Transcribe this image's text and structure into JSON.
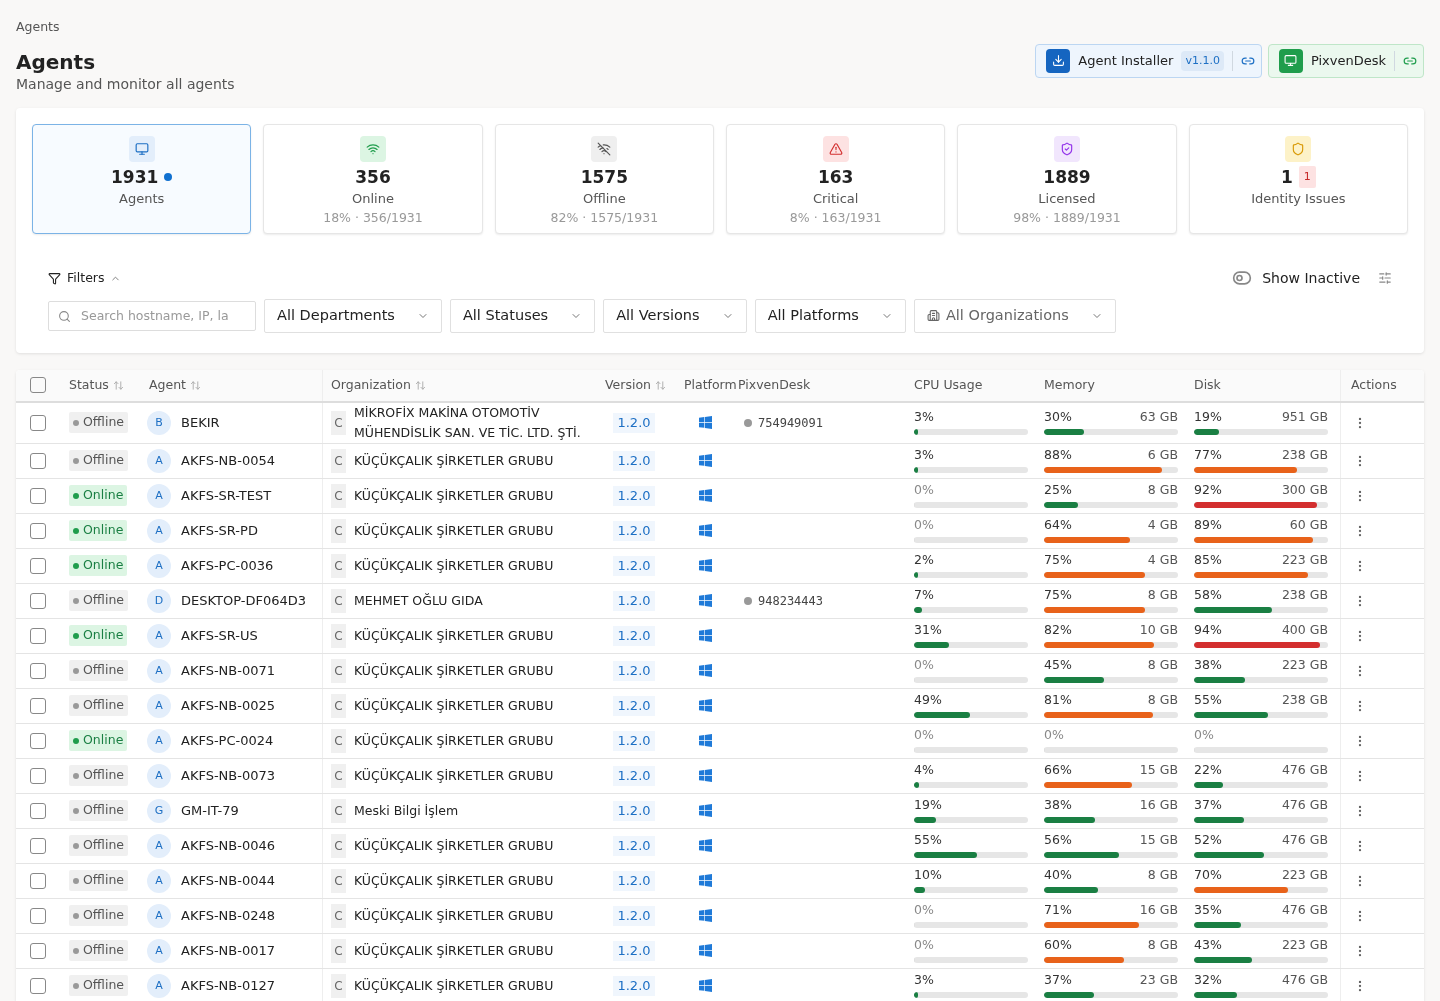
{
  "breadcrumb": "Agents",
  "header": {
    "title": "Agents",
    "subtitle": "Manage and monitor all agents"
  },
  "actions": [
    {
      "kind": "installer",
      "label": "Agent Installer",
      "badge": "v1.1.0"
    },
    {
      "kind": "desk",
      "label": "PixvenDesk"
    }
  ],
  "stats": [
    {
      "kind": "agents",
      "value": "1931",
      "label": "Agents",
      "selected": true,
      "dot": true
    },
    {
      "kind": "online",
      "value": "356",
      "label": "Online",
      "detail": "18% · 356/1931",
      "selected": false,
      "dot": false
    },
    {
      "kind": "offline",
      "value": "1575",
      "label": "Offline",
      "detail": "82% · 1575/1931",
      "selected": false,
      "dot": false
    },
    {
      "kind": "critical",
      "value": "163",
      "label": "Critical",
      "detail": "8% · 163/1931",
      "selected": false,
      "dot": false
    },
    {
      "kind": "licensed",
      "value": "1889",
      "label": "Licensed",
      "detail": "98% · 1889/1931",
      "selected": false,
      "dot": false
    },
    {
      "kind": "identity",
      "value": "1",
      "label": "Identity Issues",
      "badge": "1",
      "selected": false,
      "dot": false
    }
  ],
  "filters": {
    "label": "Filters",
    "expanded": true,
    "search": {
      "placeholder": "Search hostname, IP, la"
    },
    "show_inactive": {
      "label": "Show Inactive",
      "on": false
    },
    "dropdowns": [
      {
        "label": "All Departments"
      },
      {
        "label": "All Statuses"
      },
      {
        "label": "All Versions"
      },
      {
        "label": "All Platforms"
      },
      {
        "label": "All Organizations",
        "kind": "org"
      }
    ]
  },
  "table": {
    "select_all": {
      "checked": false
    },
    "columns": [
      {
        "label": "Status",
        "sortable": true
      },
      {
        "label": "Agent",
        "sortable": true
      },
      {
        "label": "Organization",
        "sortable": true
      },
      {
        "label": "Version",
        "sortable": true
      },
      {
        "label": "Platform",
        "sortable": false
      },
      {
        "label": "PixvenDesk",
        "sortable": false
      },
      {
        "label": "CPU Usage",
        "sortable": false
      },
      {
        "label": "Memory",
        "sortable": false
      },
      {
        "label": "Disk",
        "sortable": false
      },
      {
        "label": "Actions",
        "sortable": false
      }
    ],
    "rows": [
      {
        "checked": false,
        "status": "Offline",
        "online": false,
        "initial": "B",
        "agent": "BEKIR",
        "org_initial": "C",
        "org": "MİKROFİX MAKİNA OTOMOTİV MÜHENDİSLİK SAN. VE TİC. LTD. ŞTİ.",
        "version": "1.2.0",
        "desk": "754949091",
        "cpu": {
          "reading": "3%",
          "level": 0.03
        },
        "memory": {
          "reading": "30%",
          "size": "63 GB",
          "level": 0.3
        },
        "disk": {
          "reading": "19%",
          "size": "951 GB",
          "level": 0.19
        }
      },
      {
        "checked": false,
        "status": "Offline",
        "online": false,
        "initial": "A",
        "agent": "AKFS-NB-0054",
        "org_initial": "C",
        "org": "KÜÇÜKÇALIK ŞİRKETLER GRUBU",
        "version": "1.2.0",
        "cpu": {
          "reading": "3%",
          "level": 0.03
        },
        "memory": {
          "reading": "88%",
          "size": "6 GB",
          "level": 0.88
        },
        "disk": {
          "reading": "77%",
          "size": "238 GB",
          "level": 0.77
        }
      },
      {
        "checked": false,
        "status": "Online",
        "online": true,
        "initial": "A",
        "agent": "AKFS-SR-TEST",
        "org_initial": "C",
        "org": "KÜÇÜKÇALIK ŞİRKETLER GRUBU",
        "version": "1.2.0",
        "cpu": {
          "reading": "0%",
          "level": 0
        },
        "memory": {
          "reading": "25%",
          "size": "8 GB",
          "level": 0.25
        },
        "disk": {
          "reading": "92%",
          "size": "300 GB",
          "level": 0.92
        }
      },
      {
        "checked": false,
        "status": "Online",
        "online": true,
        "initial": "A",
        "agent": "AKFS-SR-PD",
        "org_initial": "C",
        "org": "KÜÇÜKÇALIK ŞİRKETLER GRUBU",
        "version": "1.2.0",
        "cpu": {
          "reading": "0%",
          "level": 0
        },
        "memory": {
          "reading": "64%",
          "size": "4 GB",
          "level": 0.64
        },
        "disk": {
          "reading": "89%",
          "size": "60 GB",
          "level": 0.89
        }
      },
      {
        "checked": false,
        "status": "Online",
        "online": true,
        "initial": "A",
        "agent": "AKFS-PC-0036",
        "org_initial": "C",
        "org": "KÜÇÜKÇALIK ŞİRKETLER GRUBU",
        "version": "1.2.0",
        "cpu": {
          "reading": "2%",
          "level": 0.02
        },
        "memory": {
          "reading": "75%",
          "size": "4 GB",
          "level": 0.75
        },
        "disk": {
          "reading": "85%",
          "size": "223 GB",
          "level": 0.85
        }
      },
      {
        "checked": false,
        "status": "Offline",
        "online": false,
        "initial": "D",
        "agent": "DESKTOP-DF064D3",
        "org_initial": "C",
        "org": "MEHMET OĞLU GIDA",
        "version": "1.2.0",
        "desk": "948234443",
        "cpu": {
          "reading": "7%",
          "level": 0.07
        },
        "memory": {
          "reading": "75%",
          "size": "8 GB",
          "level": 0.75
        },
        "disk": {
          "reading": "58%",
          "size": "238 GB",
          "level": 0.58
        }
      },
      {
        "checked": false,
        "status": "Online",
        "online": true,
        "initial": "A",
        "agent": "AKFS-SR-US",
        "org_initial": "C",
        "org": "KÜÇÜKÇALIK ŞİRKETLER GRUBU",
        "version": "1.2.0",
        "cpu": {
          "reading": "31%",
          "level": 0.31
        },
        "memory": {
          "reading": "82%",
          "size": "10 GB",
          "level": 0.82
        },
        "disk": {
          "reading": "94%",
          "size": "400 GB",
          "level": 0.94
        }
      },
      {
        "checked": false,
        "status": "Offline",
        "online": false,
        "initial": "A",
        "agent": "AKFS-NB-0071",
        "org_initial": "C",
        "org": "KÜÇÜKÇALIK ŞİRKETLER GRUBU",
        "version": "1.2.0",
        "cpu": {
          "reading": "0%",
          "level": 0
        },
        "memory": {
          "reading": "45%",
          "size": "8 GB",
          "level": 0.45
        },
        "disk": {
          "reading": "38%",
          "size": "223 GB",
          "level": 0.38
        }
      },
      {
        "checked": false,
        "status": "Offline",
        "online": false,
        "initial": "A",
        "agent": "AKFS-NB-0025",
        "org_initial": "C",
        "org": "KÜÇÜKÇALIK ŞİRKETLER GRUBU",
        "version": "1.2.0",
        "cpu": {
          "reading": "49%",
          "level": 0.49
        },
        "memory": {
          "reading": "81%",
          "size": "8 GB",
          "level": 0.81
        },
        "disk": {
          "reading": "55%",
          "size": "238 GB",
          "level": 0.55
        }
      },
      {
        "checked": false,
        "status": "Online",
        "online": true,
        "initial": "A",
        "agent": "AKFS-PC-0024",
        "org_initial": "C",
        "org": "KÜÇÜKÇALIK ŞİRKETLER GRUBU",
        "version": "1.2.0",
        "cpu": {
          "reading": "0%",
          "level": 0
        },
        "memory": {
          "reading": "0%",
          "level": 0
        },
        "disk": {
          "reading": "0%",
          "level": 0
        }
      },
      {
        "checked": false,
        "status": "Offline",
        "online": false,
        "initial": "A",
        "agent": "AKFS-NB-0073",
        "org_initial": "C",
        "org": "KÜÇÜKÇALIK ŞİRKETLER GRUBU",
        "version": "1.2.0",
        "cpu": {
          "reading": "4%",
          "level": 0.04
        },
        "memory": {
          "reading": "66%",
          "size": "15 GB",
          "level": 0.66
        },
        "disk": {
          "reading": "22%",
          "size": "476 GB",
          "level": 0.22
        }
      },
      {
        "checked": false,
        "status": "Offline",
        "online": false,
        "initial": "G",
        "agent": "GM-IT-79",
        "org_initial": "C",
        "org": "Meski Bilgi İşlem",
        "version": "1.2.0",
        "cpu": {
          "reading": "19%",
          "level": 0.19
        },
        "memory": {
          "reading": "38%",
          "size": "16 GB",
          "level": 0.38
        },
        "disk": {
          "reading": "37%",
          "size": "476 GB",
          "level": 0.37
        }
      },
      {
        "checked": false,
        "status": "Offline",
        "online": false,
        "initial": "A",
        "agent": "AKFS-NB-0046",
        "org_initial": "C",
        "org": "KÜÇÜKÇALIK ŞİRKETLER GRUBU",
        "version": "1.2.0",
        "cpu": {
          "reading": "55%",
          "level": 0.55
        },
        "memory": {
          "reading": "56%",
          "size": "15 GB",
          "level": 0.56
        },
        "disk": {
          "reading": "52%",
          "size": "476 GB",
          "level": 0.52
        }
      },
      {
        "checked": false,
        "status": "Offline",
        "online": false,
        "initial": "A",
        "agent": "AKFS-NB-0044",
        "org_initial": "C",
        "org": "KÜÇÜKÇALIK ŞİRKETLER GRUBU",
        "version": "1.2.0",
        "cpu": {
          "reading": "10%",
          "level": 0.1
        },
        "memory": {
          "reading": "40%",
          "size": "8 GB",
          "level": 0.4
        },
        "disk": {
          "reading": "70%",
          "size": "223 GB",
          "level": 0.7
        }
      },
      {
        "checked": false,
        "status": "Offline",
        "online": false,
        "initial": "A",
        "agent": "AKFS-NB-0248",
        "org_initial": "C",
        "org": "KÜÇÜKÇALIK ŞİRKETLER GRUBU",
        "version": "1.2.0",
        "cpu": {
          "reading": "0%",
          "level": 0
        },
        "memory": {
          "reading": "71%",
          "size": "16 GB",
          "level": 0.71
        },
        "disk": {
          "reading": "35%",
          "size": "476 GB",
          "level": 0.35
        }
      },
      {
        "checked": false,
        "status": "Offline",
        "online": false,
        "initial": "A",
        "agent": "AKFS-NB-0017",
        "org_initial": "C",
        "org": "KÜÇÜKÇALIK ŞİRKETLER GRUBU",
        "version": "1.2.0",
        "cpu": {
          "reading": "0%",
          "level": 0
        },
        "memory": {
          "reading": "60%",
          "size": "8 GB",
          "level": 0.6
        },
        "disk": {
          "reading": "43%",
          "size": "223 GB",
          "level": 0.43
        }
      },
      {
        "checked": false,
        "status": "Offline",
        "online": false,
        "initial": "A",
        "agent": "AKFS-NB-0127",
        "org_initial": "C",
        "org": "KÜÇÜKÇALIK ŞİRKETLER GRUBU",
        "version": "1.2.0",
        "cpu": {
          "reading": "3%",
          "level": 0.03
        },
        "memory": {
          "reading": "37%",
          "size": "23 GB",
          "level": 0.37
        },
        "disk": {
          "reading": "32%",
          "size": "476 GB",
          "level": 0.32
        }
      }
    ]
  }
}
